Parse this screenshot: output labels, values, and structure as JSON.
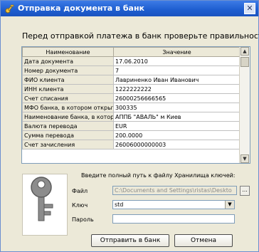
{
  "window": {
    "title": "Отправка документа в банк",
    "close_label": "✕"
  },
  "instruction": "Перед отправкой платежа в банк проверьте правильность",
  "table": {
    "headers": [
      "Наименование",
      "Значение"
    ],
    "rows": [
      {
        "name": "Дата документа",
        "value": "17.06.2010"
      },
      {
        "name": "Номер документа",
        "value": "7"
      },
      {
        "name": "ФИО клиента",
        "value": "Лавриненко Иван Иванович"
      },
      {
        "name": "ИНН клиента",
        "value": "1222222222"
      },
      {
        "name": "Счет списания",
        "value": "26000256666565"
      },
      {
        "name": "МФО банка, в котором открыт...",
        "value": "300335"
      },
      {
        "name": "Наименование банка, в котор...",
        "value": "АППБ \"АВАЛЬ\" м Киев"
      },
      {
        "name": "Валюта перевода",
        "value": "EUR"
      },
      {
        "name": "Сумма перевода",
        "value": "200.0000"
      },
      {
        "name": "Счет зачисления",
        "value": "26006000000003"
      }
    ]
  },
  "key_storage": {
    "prompt": "Введите полный путь к файлу Хранилища ключей:",
    "file_label": "Файл",
    "file_value": "C:\\Documents and Settings\\ristas\\Deskto",
    "browse_label": "...",
    "key_label": "Ключ",
    "key_value": "std",
    "password_label": "Пароль",
    "password_value": ""
  },
  "buttons": {
    "send": "Отправить в банк",
    "cancel": "Отмена"
  },
  "colors": {
    "titlebar": "#1f5fd1",
    "dialog_bg": "#ECE9D8",
    "border": "#7f9db9"
  }
}
